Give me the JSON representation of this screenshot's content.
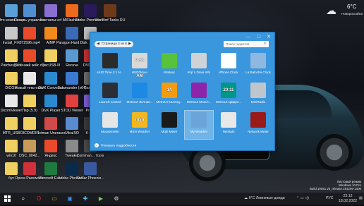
{
  "desktop": {
    "icons": [
      {
        "label": "Это компьютер",
        "col": 0,
        "row": 0,
        "color": "#5aa0d8"
      },
      {
        "label": "Панель управления",
        "col": 1,
        "row": 0,
        "color": "#4f8fd0"
      },
      {
        "label": "Контакты.vcf",
        "col": 2,
        "row": 0,
        "color": "#8a6fd0"
      },
      {
        "label": "MiFlashPro",
        "col": 3,
        "row": 0,
        "color": "#f06a1c"
      },
      {
        "label": "Adobe Premiere Pro",
        "col": 4,
        "row": 0,
        "color": "#2a1a5a"
      },
      {
        "label": "World of Tanks RU",
        "col": 5,
        "row": 0,
        "color": "#6e3a1a"
      },
      {
        "label": "Install_FIX",
        "col": 0,
        "row": 1,
        "color": "#c8c8c8"
      },
      {
        "label": "072596.mp4",
        "col": 1,
        "row": 1,
        "color": "#e84a2a"
      },
      {
        "label": "AIMP",
        "col": 2,
        "row": 1,
        "color": "#f08a1a"
      },
      {
        "label": "Paragon Hard Disk ...",
        "col": 3,
        "row": 1,
        "color": "#3a6ab8"
      },
      {
        "label": "",
        "col": 4,
        "row": 1,
        "color": "#bbbbbb"
      },
      {
        "label": "Patches_FIX",
        "col": 0,
        "row": 2,
        "color": "#f0d060"
      },
      {
        "label": "Весенний кейс.mp4",
        "col": 1,
        "row": 2,
        "color": "#e84a2a"
      },
      {
        "label": "DiscUSB-III",
        "col": 2,
        "row": 2,
        "color": "#f0d060"
      },
      {
        "label": "Recuva",
        "col": 3,
        "row": 2,
        "color": "#5a9ad0"
      },
      {
        "label": "DVDFab",
        "col": 4,
        "row": 2,
        "color": "#c03030"
      },
      {
        "label": "DICOM",
        "col": 0,
        "row": 3,
        "color": "#f0d060"
      },
      {
        "label": "Новый текстовый",
        "col": 1,
        "row": 3,
        "color": "#e8e8e8"
      },
      {
        "label": "DivX Converter",
        "col": 2,
        "row": 3,
        "color": "#2a8ad0"
      },
      {
        "label": "Salamander (x64)",
        "col": 3,
        "row": 3,
        "color": "#3a7ad0"
      },
      {
        "label": "Game...",
        "col": 4,
        "row": 3,
        "color": "#6a6a6a"
      },
      {
        "label": "DicomViewer",
        "col": 0,
        "row": 4,
        "color": "#e8e8e8"
      },
      {
        "label": "Пар (5.9)",
        "col": 1,
        "row": 4,
        "color": "#f0d060"
      },
      {
        "label": "DivX Player",
        "col": 2,
        "row": 4,
        "color": "#2a8ad0"
      },
      {
        "label": "STDU Viewer",
        "col": 3,
        "row": 4,
        "color": "#e04040"
      },
      {
        "label": "Pro...",
        "col": 4,
        "row": 4,
        "color": "#7a5ad0"
      },
      {
        "label": "MTR_USB",
        "col": 0,
        "row": 5,
        "color": "#f0d060"
      },
      {
        "label": "DICOMDIR",
        "col": 1,
        "row": 5,
        "color": "#f0d060"
      },
      {
        "label": "Hetman Uneraser",
        "col": 2,
        "row": 5,
        "color": "#d04a4a"
      },
      {
        "label": "UltraISO",
        "col": 3,
        "row": 5,
        "color": "#5a8ad0"
      },
      {
        "label": "K-S...",
        "col": 4,
        "row": 5,
        "color": "#3a3a3a"
      },
      {
        "label": "win10",
        "col": 0,
        "row": 6,
        "color": "#f0d060"
      },
      {
        "label": "DSC_0042...",
        "col": 1,
        "row": 6,
        "color": "#c89a5a"
      },
      {
        "label": "Яндекс",
        "col": 2,
        "row": 6,
        "color": "#e84a2a"
      },
      {
        "label": "Tweaker",
        "col": 3,
        "row": 6,
        "color": "#8a8a8a"
      },
      {
        "label": "Comman... Tools",
        "col": 4,
        "row": 6,
        "color": "#4a4a4a"
      },
      {
        "label": "бус",
        "col": 0,
        "row": 7,
        "color": "#f0d060"
      },
      {
        "label": "Opera Passwords",
        "col": 1,
        "row": 7,
        "color": "#d0303a"
      },
      {
        "label": "Microsoft Excel",
        "col": 2,
        "row": 7,
        "color": "#1f7a40"
      },
      {
        "label": "Adobe Photosh...",
        "col": 3,
        "row": 7,
        "color": "#0a2a4a"
      },
      {
        "label": "Stellar Phoenix...",
        "col": 4,
        "row": 7,
        "color": "#3a5aa0"
      }
    ]
  },
  "weather_widget": {
    "icon": "cloud-snow-icon",
    "temp": "6°C",
    "city": "Новороссийск"
  },
  "gadget_window": {
    "title_controls": {
      "minimize": "—",
      "maximize": "□",
      "close": "✕"
    },
    "pager_text": "Страница 4 из 6",
    "search_placeholder": "Поиск гаджетов",
    "details_text": "Показать подробности",
    "gadgets": [
      {
        "label": "HUD Time 3.1 N...",
        "icon": "hud-time-icon",
        "display": "",
        "color": "#2b2b2b",
        "selected": false
      },
      {
        "label": "HUDTime+",
        "icon": "hudtime-plus-icon",
        "display": "9:53 AM",
        "color": "#d9d9d9",
        "selected": false
      },
      {
        "label": "iBattery",
        "icon": "battery-icon",
        "display": "",
        "color": "#58c23a",
        "selected": false
      },
      {
        "label": "Imp´s Drive Info",
        "icon": "drive-info-icon",
        "display": "",
        "color": "#cfd3d6",
        "selected": false
      },
      {
        "label": "iPhone Clock",
        "icon": "clock-icon",
        "display": "",
        "color": "#ffffff",
        "selected": false
      },
      {
        "label": "La Baloche Clock",
        "icon": "calendar-clock-icon",
        "display": "",
        "color": "#8fb8e0",
        "selected": false
      },
      {
        "label": "Launch Control",
        "icon": "launch-control-icon",
        "display": "",
        "color": "#2b2f35",
        "selected": false
      },
      {
        "label": "MetroUI Личная...",
        "icon": "metro-photo-icon",
        "display": "",
        "color": "#1e88e5",
        "selected": false
      },
      {
        "label": "MetroUI Календ...",
        "icon": "metro-calendar-icon",
        "display": "14",
        "color": "#f39c12",
        "selected": false
      },
      {
        "label": "MetroUI Монит...",
        "icon": "metro-monitor-icon",
        "display": "",
        "color": "#8e24aa",
        "selected": false
      },
      {
        "label": "MetroUI Цифро...",
        "icon": "metro-digital-clock-icon",
        "display": "20:11",
        "color": "#009688",
        "selected": false
      },
      {
        "label": "MiniRadio",
        "icon": "radio-icon",
        "display": "",
        "color": "#bfc5cc",
        "selected": false
      },
      {
        "label": "Mousemeter",
        "icon": "mouse-icon",
        "display": "",
        "color": "#e6e6e6",
        "selected": false
      },
      {
        "label": "MSN Weather",
        "icon": "msn-icon",
        "display": "msn",
        "color": "#f2b81f",
        "selected": false
      },
      {
        "label": "Multi Meter",
        "icon": "multi-meter-icon",
        "display": "",
        "color": "#1a1a1a",
        "selected": false
      },
      {
        "label": "My Weather",
        "icon": "weather-icon",
        "display": "",
        "color": "#6aa4d9",
        "selected": true
      },
      {
        "label": "Netstats",
        "icon": "netstats-icon",
        "display": "",
        "color": "#e8e8e8",
        "selected": false
      },
      {
        "label": "Network Meter",
        "icon": "network-meter-icon",
        "display": "",
        "color": "#9a1a1a",
        "selected": false
      }
    ]
  },
  "watermark": {
    "line1": "Листовый режим",
    "line2": "Windows 10 Pro",
    "line3": "Build 19041.vb_release.191206-1406"
  },
  "taskbar": {
    "start_icon": "windows-start-icon",
    "pinned": [
      {
        "name": "search-icon",
        "glyph": "⌕",
        "color": "#ffffff"
      },
      {
        "name": "opera-icon",
        "glyph": "O",
        "color": "#e0303a"
      },
      {
        "name": "file-explorer-icon",
        "glyph": "▭",
        "color": "#f2c744"
      },
      {
        "name": "store-icon",
        "glyph": "▣",
        "color": "#3a8ee6"
      },
      {
        "name": "sticky-icon",
        "glyph": "✚",
        "color": "#4cc2ff"
      },
      {
        "name": "media-icon",
        "glyph": "▶",
        "color": "#6ad05a"
      },
      {
        "name": "settings-icon",
        "glyph": "⚙",
        "color": "#d6d6d6"
      }
    ],
    "weather_temp": "6°C",
    "weather_text": "Ливневые дожди",
    "language": "РУС",
    "time": "23:12",
    "date": "18.02.2022"
  }
}
